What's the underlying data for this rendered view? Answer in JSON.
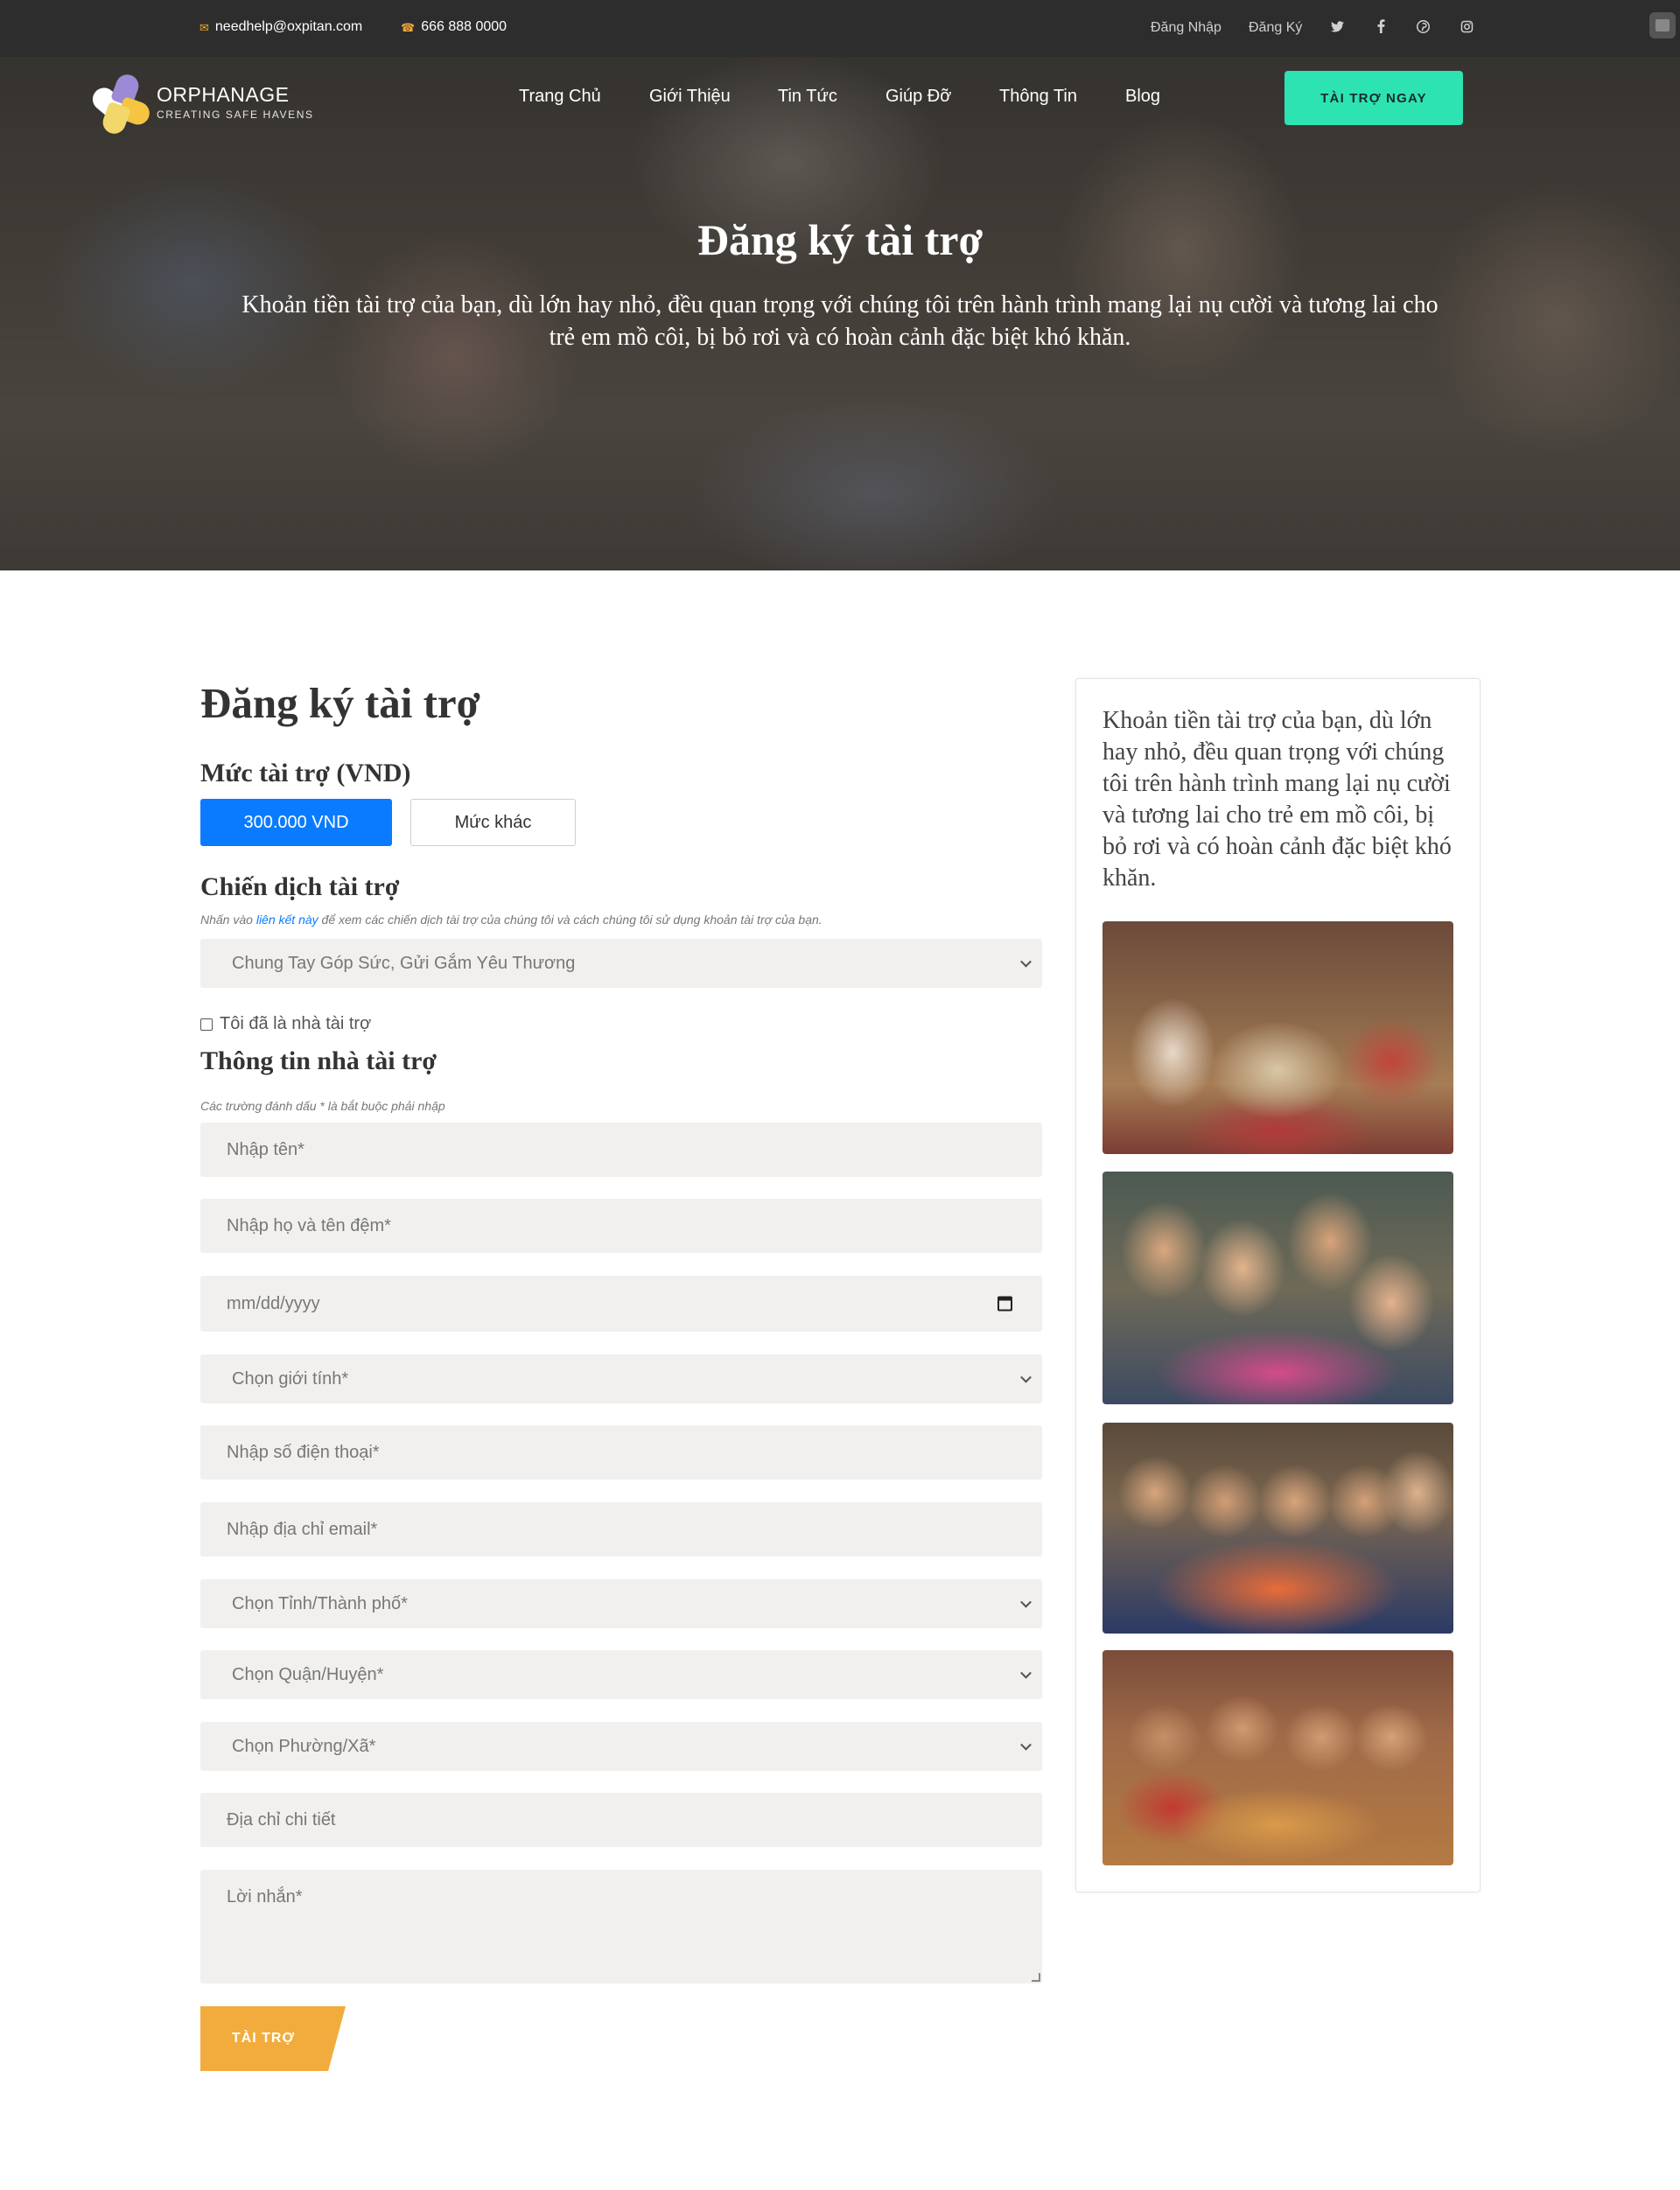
{
  "topbar": {
    "email": "needhelp@oxpitan.com",
    "phone": "666 888 0000",
    "login": "Đăng Nhập",
    "register": "Đăng Ký",
    "email_icon": "envelope-icon",
    "phone_icon": "phone-icon",
    "social": [
      "twitter-icon",
      "facebook-icon",
      "pinterest-icon",
      "instagram-icon"
    ]
  },
  "header": {
    "logo_title": "ORPHANAGE",
    "logo_subtitle": "CREATING SAFE HAVENS",
    "nav": [
      "Trang Chủ",
      "Giới Thiệu",
      "Tin Tức",
      "Giúp Đỡ",
      "Thông Tin",
      "Blog"
    ],
    "cta": "TÀI TRỢ NGAY"
  },
  "hero": {
    "title": "Đăng ký tài trợ",
    "subtitle": "Khoản tiền tài trợ của bạn, dù lớn hay nhỏ, đều quan trọng với chúng tôi trên hành trình mang lại nụ cười và tương lai cho trẻ em mồ côi, bị bỏ rơi và có hoàn cảnh đặc biệt khó khăn."
  },
  "form": {
    "title": "Đăng ký tài trợ",
    "amount_label": "Mức tài trợ (VND)",
    "amount_selected": "300.000 VND",
    "amount_other": "Mức khác",
    "campaign_label": "Chiến dịch tài trợ",
    "campaign_hint_before": "Nhấn vào ",
    "campaign_hint_link": "liên kết này",
    "campaign_hint_after": " để xem các chiến dịch tài trợ của chúng tôi và cách chúng tôi sử dụng khoản tài trợ của bạn.",
    "campaign_value": "Chung Tay Góp Sức, Gửi Gắm Yêu Thương",
    "existing_sponsor": "Tôi đã là nhà tài trợ",
    "sponsor_info_label": "Thông tin nhà tài trợ",
    "required_note": "Các trường đánh dấu * là bắt buộc phải nhập",
    "first_name": "Nhập tên*",
    "last_name": "Nhập họ và tên đệm*",
    "dob": "mm/dd/yyyy",
    "gender": "Chọn giới tính*",
    "phone": "Nhập số điện thoại*",
    "email": "Nhập địa chỉ email*",
    "province": "Chọn Tỉnh/Thành phố*",
    "district": "Chọn Quận/Huyện*",
    "ward": "Chọn Phường/Xã*",
    "address": "Địa chỉ chi tiết",
    "message": "Lời nhắn*",
    "submit": "TÀI TRỢ"
  },
  "sidebar": {
    "text": "Khoản tiền tài trợ của bạn, dù lớn hay nhỏ, đều quan trọng với chúng tôi trên hành trình mang lại nụ cười và tương lai cho trẻ em mồ côi, bị bỏ rơi và có hoàn cảnh đặc biệt khó khăn."
  },
  "colors": {
    "topbar_bg": "#2d2d2d",
    "cta_bg": "#2de3b2",
    "primary_blue": "#0a7bff",
    "submit_orange": "#f2ac3d",
    "field_bg": "#f1f0ee"
  }
}
